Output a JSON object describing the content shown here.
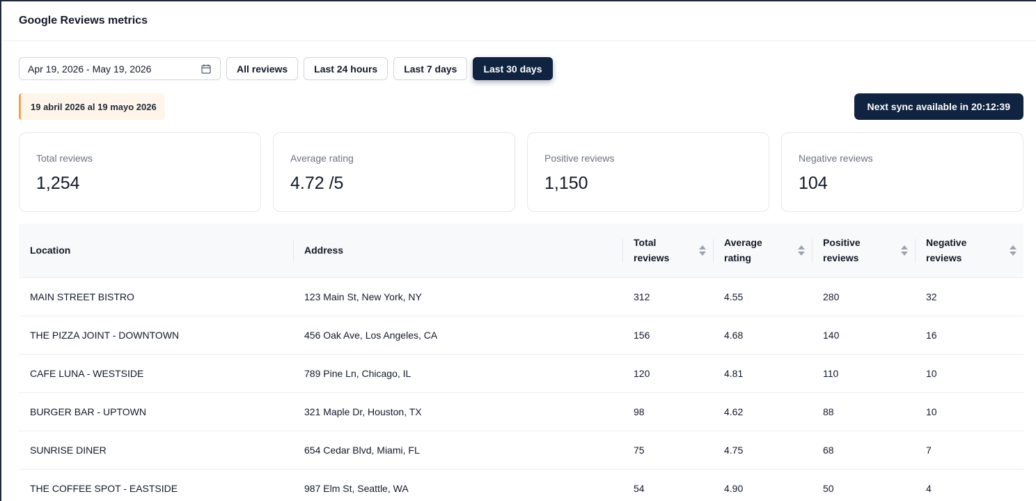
{
  "header": {
    "title": "Google Reviews metrics"
  },
  "filters": {
    "date_range_value": "Apr 19, 2026 - May 19, 2026",
    "calendar_icon": "calendar-icon",
    "buttons": [
      "All reviews",
      "Last 24 hours",
      "Last 7 days",
      "Last 30 days"
    ],
    "active": "Last 30 days"
  },
  "range_label": "19 abril 2026 al 19 mayo 2026",
  "sync_button": "Next sync available in 20:12:39",
  "cards": [
    {
      "label": "Total reviews",
      "value": "1,254"
    },
    {
      "label": "Average rating",
      "value": "4.72 /5"
    },
    {
      "label": "Positive reviews",
      "value": "1,150"
    },
    {
      "label": "Negative reviews",
      "value": "104"
    }
  ],
  "table": {
    "columns": [
      "Location",
      "Address",
      "Total\nreviews",
      "Average\nrating",
      "Positive\nreviews",
      "Negative\nreviews"
    ],
    "rows": [
      [
        "MAIN STREET BISTRO",
        "123 Main St, New York, NY",
        "312",
        "4.55",
        "280",
        "32"
      ],
      [
        "THE PIZZA JOINT - DOWNTOWN",
        "456 Oak Ave, Los Angeles, CA",
        "156",
        "4.68",
        "140",
        "16"
      ],
      [
        "CAFE LUNA - WESTSIDE",
        "789 Pine Ln, Chicago, IL",
        "120",
        "4.81",
        "110",
        "10"
      ],
      [
        "BURGER BAR - UPTOWN",
        "321 Maple Dr, Houston, TX",
        "98",
        "4.62",
        "88",
        "10"
      ],
      [
        "SUNRISE DINER",
        "654 Cedar Blvd, Miami, FL",
        "75",
        "4.75",
        "68",
        "7"
      ],
      [
        "THE COFFEE SPOT - EASTSIDE",
        "987 Elm St, Seattle, WA",
        "54",
        "4.90",
        "50",
        "4"
      ]
    ]
  },
  "colors": {
    "primary": "#102340",
    "accent_border": "#f6a04c",
    "range_bg": "#fff5ea"
  }
}
